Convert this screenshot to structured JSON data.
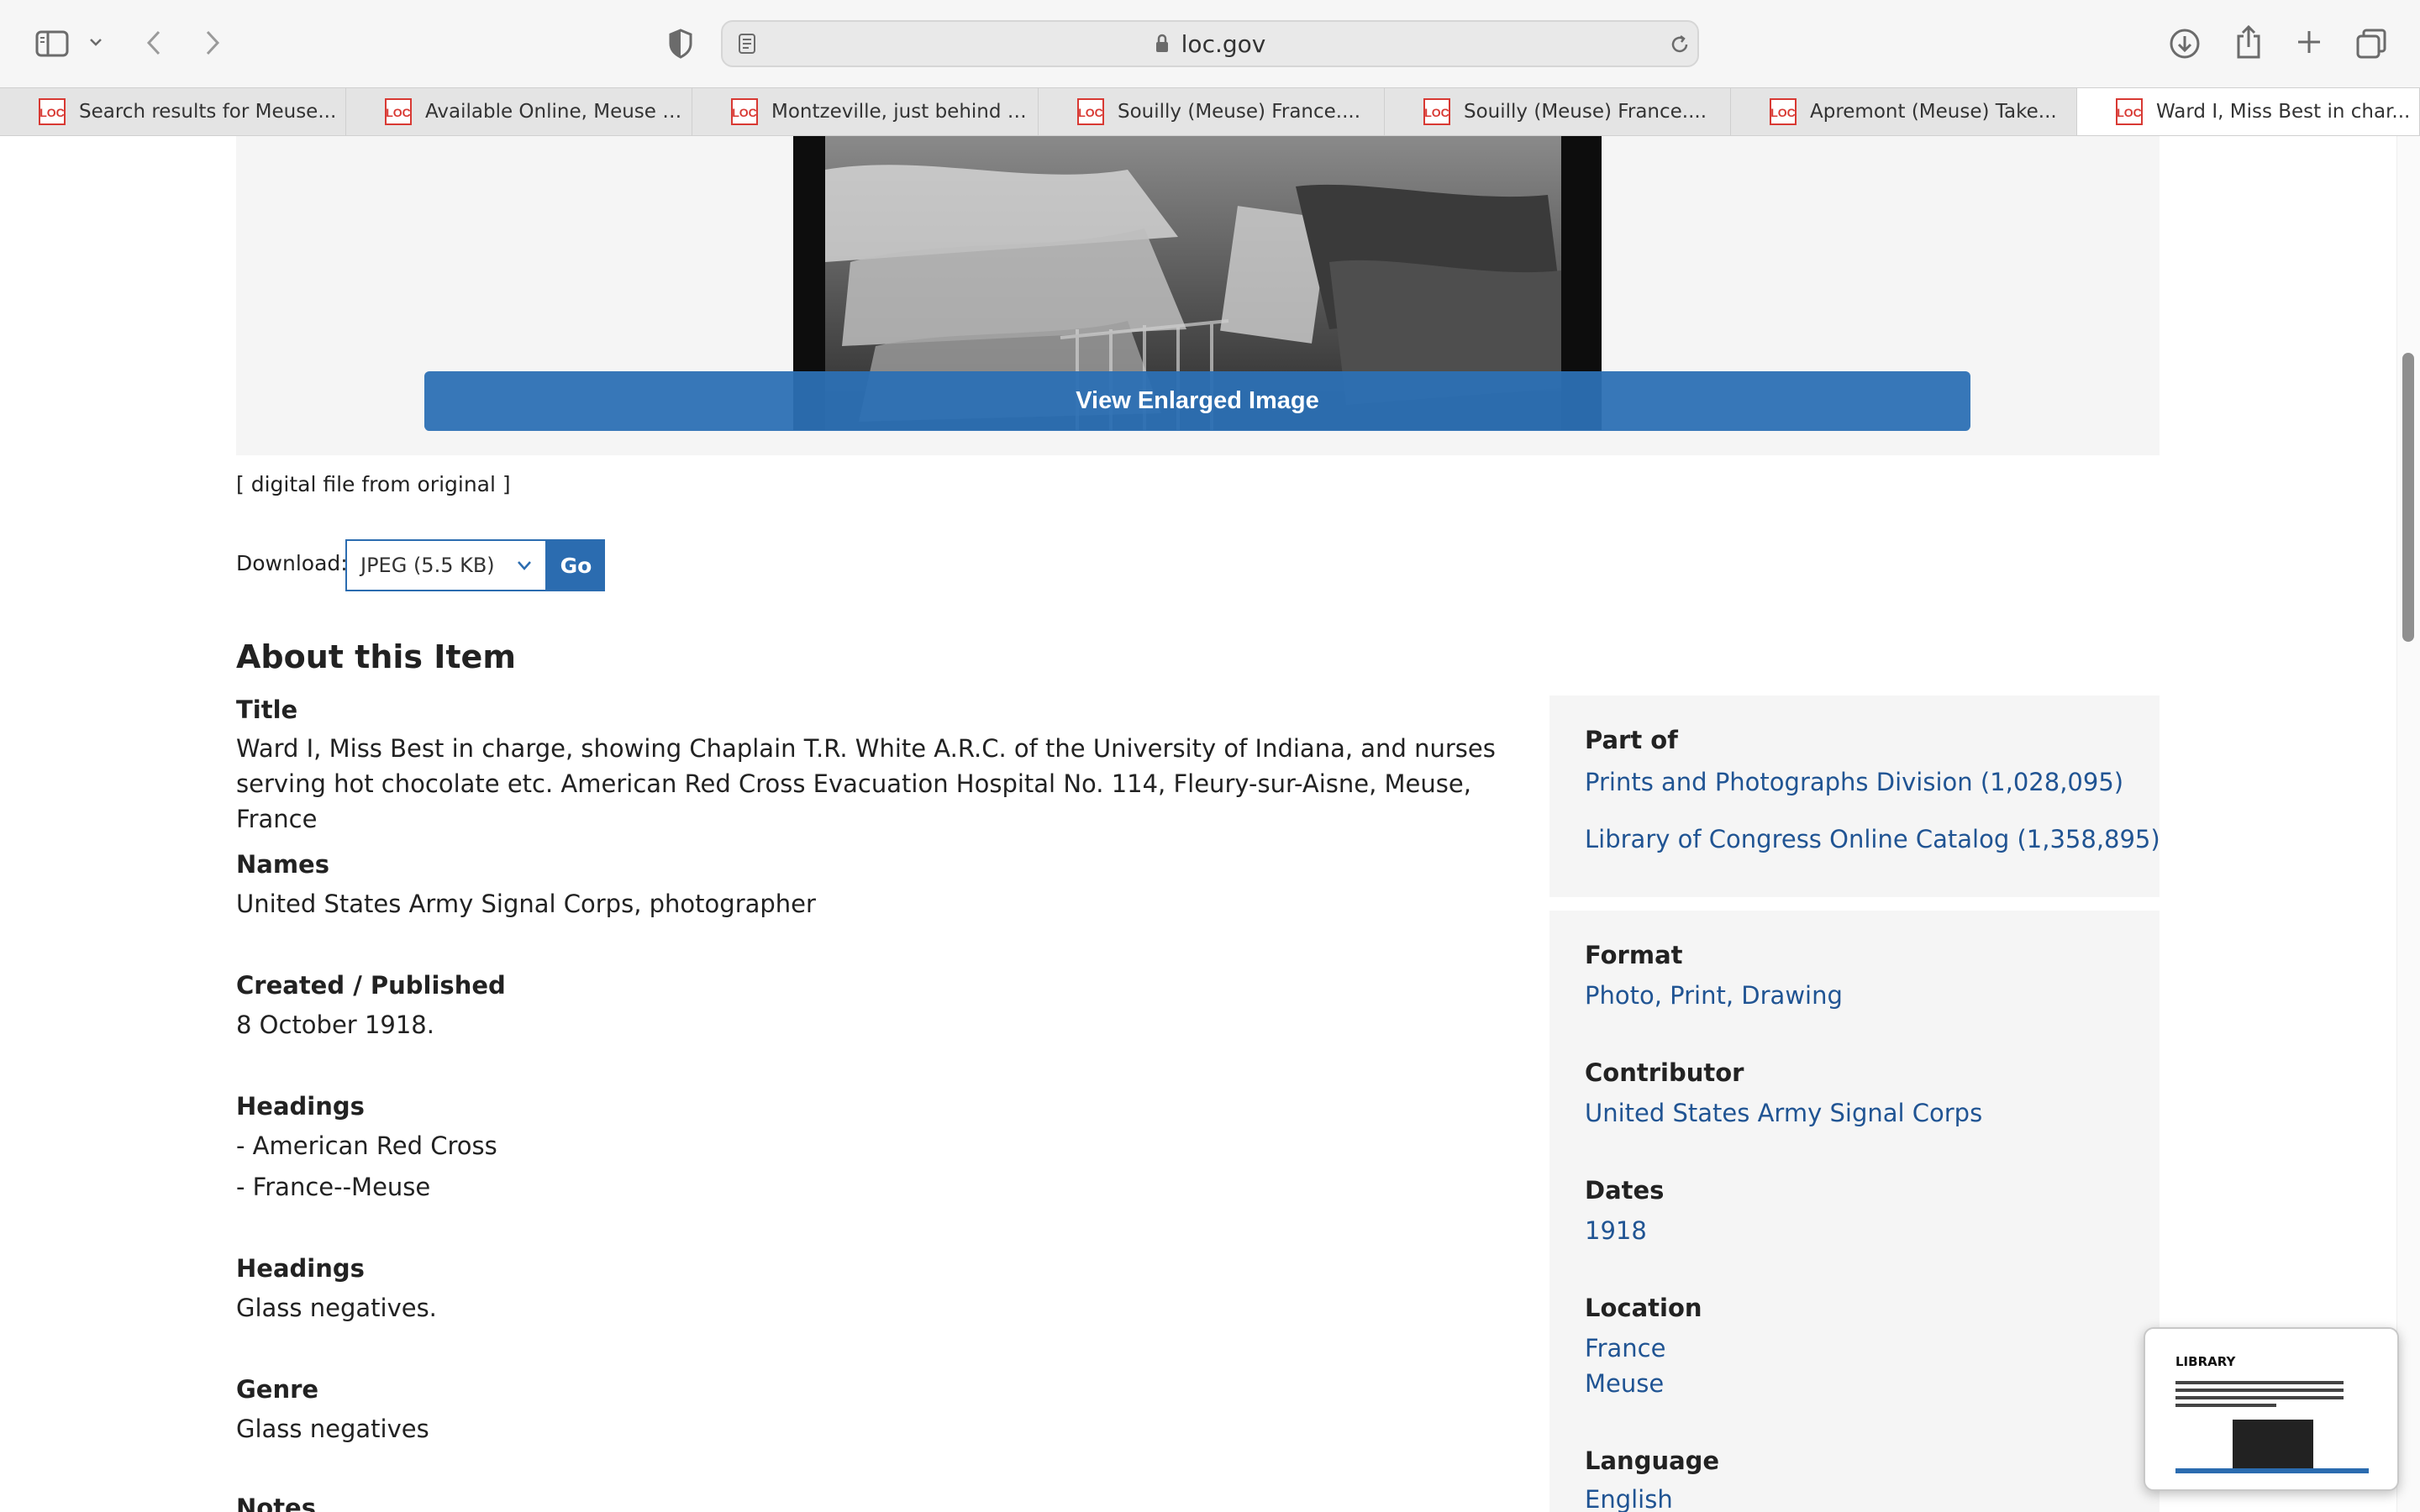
{
  "browser": {
    "url": "loc.gov",
    "tabs": [
      {
        "title": "Search results for Meuse..."
      },
      {
        "title": "Available Online, Meuse |..."
      },
      {
        "title": "Montzeville, just behind t..."
      },
      {
        "title": "Souilly (Meuse) France...."
      },
      {
        "title": "Souilly (Meuse) France...."
      },
      {
        "title": "Apremont (Meuse) Take..."
      },
      {
        "title": "Ward I, Miss Best in char..."
      }
    ],
    "favicon_text": "LOC",
    "accent_color": "#d83933"
  },
  "viewer": {
    "enlarge_label": "View Enlarged Image"
  },
  "digital_file": "[ digital file from original ]",
  "download": {
    "label": "Download:",
    "selected": "JPEG (5.5 KB)",
    "go_label": "Go"
  },
  "about": {
    "heading": "About this Item",
    "title_label": "Title",
    "title_value": "Ward I, Miss Best in charge, showing Chaplain T.R. White A.R.C. of the University of Indiana, and nurses serving hot chocolate etc. American Red Cross Evacuation Hospital No. 114, Fleury-sur-Aisne, Meuse, France",
    "names_label": "Names",
    "names_value": "United States Army Signal Corps, photographer",
    "created_label": "Created / Published",
    "created_value": "8 October 1918.",
    "headings1_label": "Headings",
    "headings1_items": [
      "-  American Red Cross",
      "-  France--Meuse"
    ],
    "headings2_label": "Headings",
    "headings2_value": "Glass negatives.",
    "genre_label": "Genre",
    "genre_value": "Glass negatives",
    "notes_label": "Notes"
  },
  "sidebar": {
    "part_of_label": "Part of",
    "part_of_links": [
      "Prints and Photographs Division (1,028,095)",
      "Library of Congress Online Catalog (1,358,895)"
    ],
    "format_label": "Format",
    "format_value": "Photo, Print, Drawing",
    "contributor_label": "Contributor",
    "contributor_value": "United States Army Signal Corps",
    "dates_label": "Dates",
    "dates_value": "1918",
    "location_label": "Location",
    "location_values": [
      "France",
      "Meuse"
    ],
    "language_label": "Language",
    "language_value": "English"
  },
  "thumbnail": {
    "logo_text": "LIBRARY"
  },
  "colors": {
    "link": "#205493",
    "button": "#2b6cb0",
    "panel": "#f5f5f5"
  }
}
